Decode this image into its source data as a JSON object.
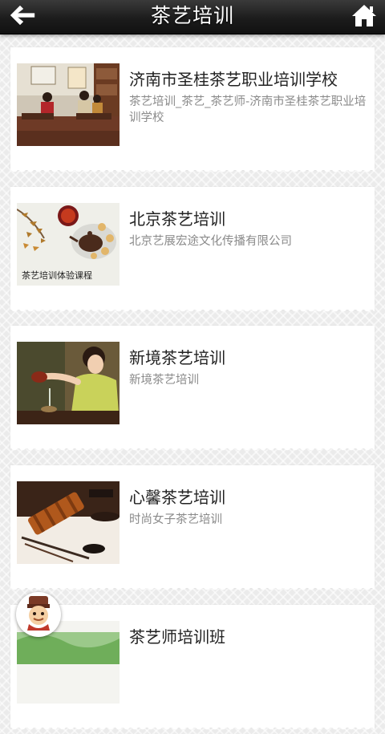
{
  "header": {
    "title": "茶艺培训",
    "back_icon": "arrow-left-icon",
    "home_icon": "home-icon"
  },
  "list": {
    "items": [
      {
        "title": "济南市圣桂茶艺职业培训学校",
        "desc": "茶艺培训_茶艺_茶艺师-济南市圣桂茶艺职业培训学校",
        "image": "classroom-photo"
      },
      {
        "title": "北京茶艺培训",
        "desc": "北京艺展宏途文化传播有限公司",
        "image": "teaset-painting",
        "image_caption": "茶艺培训体验课程"
      },
      {
        "title": "新境茶艺培训",
        "desc": "新境茶艺培训",
        "image": "tea-pouring-woman-photo"
      },
      {
        "title": "心馨茶艺培训",
        "desc": "时尚女子茶艺培训",
        "image": "bamboo-tea-tools-photo"
      },
      {
        "title": "茶艺师培训班",
        "desc": "",
        "image": "green-tea-photo"
      }
    ]
  },
  "floating_button": {
    "icon": "chef-avatar-icon"
  },
  "colors": {
    "topbar": "#1c1c1c",
    "title_text": "#ffffff",
    "item_title": "#222222",
    "item_desc": "#8a8a8a",
    "background": "#ebebeb"
  }
}
